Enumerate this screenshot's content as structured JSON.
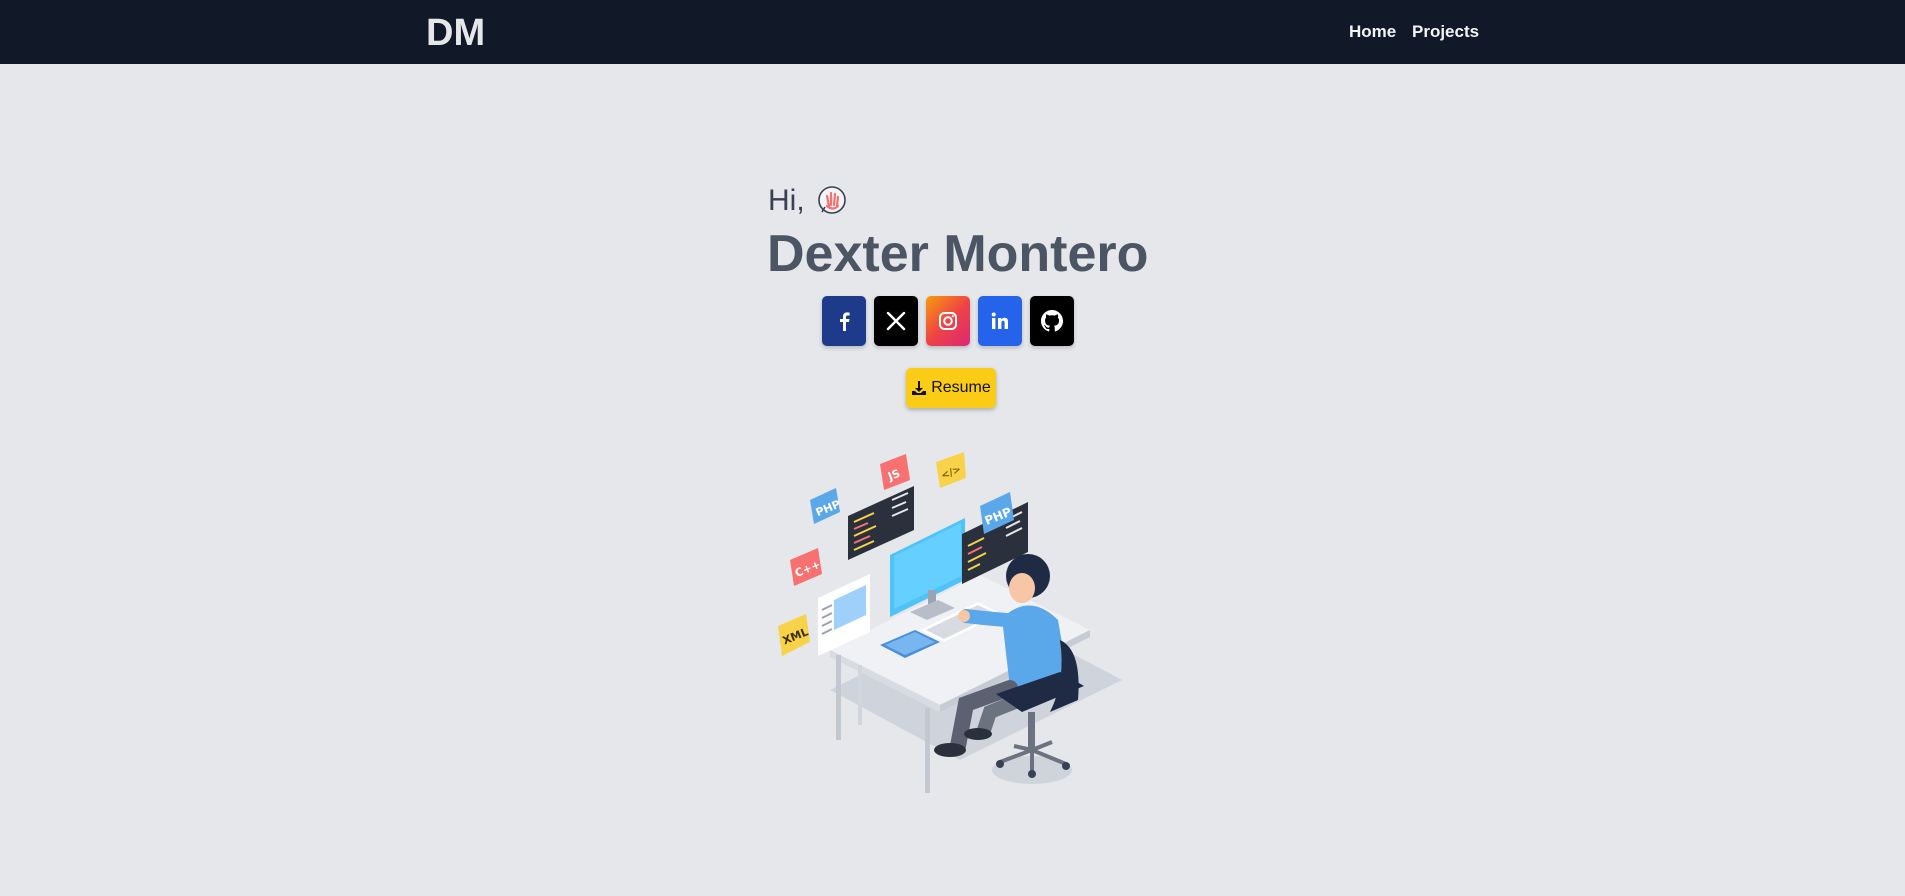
{
  "nav": {
    "brand": "DM",
    "links": [
      {
        "label": "Home"
      },
      {
        "label": "Projects"
      }
    ]
  },
  "hero": {
    "greeting": "Hi,",
    "name": "Dexter Montero",
    "socials": [
      {
        "name": "facebook",
        "icon": "facebook-icon",
        "color": "#1e3a8a"
      },
      {
        "name": "x",
        "icon": "x-icon",
        "color": "#000000"
      },
      {
        "name": "instagram",
        "icon": "instagram-icon",
        "color": "#ef4444"
      },
      {
        "name": "linkedin",
        "icon": "linkedin-icon",
        "color": "#2563eb"
      },
      {
        "name": "github",
        "icon": "github-icon",
        "color": "#000000"
      }
    ],
    "resume_label": "Resume"
  },
  "illustration": {
    "tags": [
      "PHP",
      "JS",
      "</>",
      "C++",
      "XML",
      "PHP"
    ]
  },
  "colors": {
    "navbar": "#111827",
    "background": "#e5e7eb",
    "resume_button": "#facc15"
  }
}
